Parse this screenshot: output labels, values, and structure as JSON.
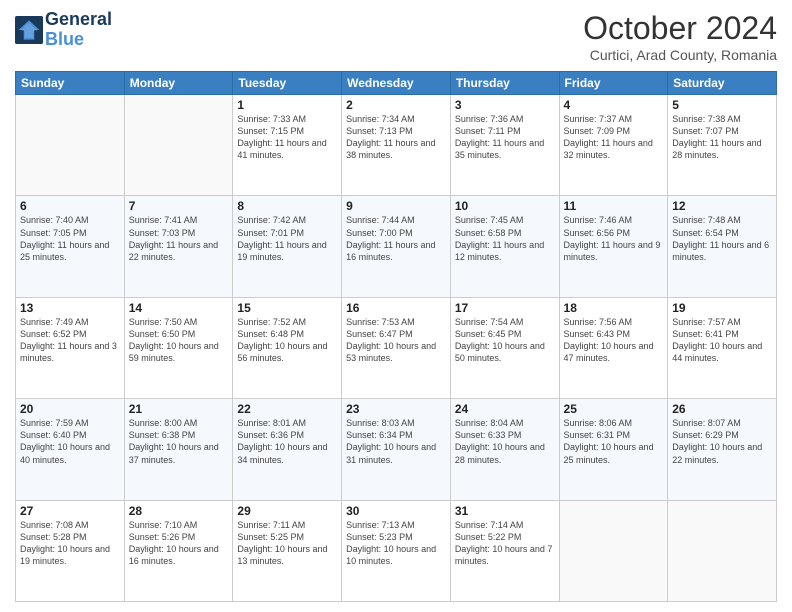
{
  "header": {
    "logo_line1": "General",
    "logo_line2": "Blue",
    "month_title": "October 2024",
    "location": "Curtici, Arad County, Romania"
  },
  "days_of_week": [
    "Sunday",
    "Monday",
    "Tuesday",
    "Wednesday",
    "Thursday",
    "Friday",
    "Saturday"
  ],
  "weeks": [
    [
      {
        "day": "",
        "info": ""
      },
      {
        "day": "",
        "info": ""
      },
      {
        "day": "1",
        "info": "Sunrise: 7:33 AM\nSunset: 7:15 PM\nDaylight: 11 hours and 41 minutes."
      },
      {
        "day": "2",
        "info": "Sunrise: 7:34 AM\nSunset: 7:13 PM\nDaylight: 11 hours and 38 minutes."
      },
      {
        "day": "3",
        "info": "Sunrise: 7:36 AM\nSunset: 7:11 PM\nDaylight: 11 hours and 35 minutes."
      },
      {
        "day": "4",
        "info": "Sunrise: 7:37 AM\nSunset: 7:09 PM\nDaylight: 11 hours and 32 minutes."
      },
      {
        "day": "5",
        "info": "Sunrise: 7:38 AM\nSunset: 7:07 PM\nDaylight: 11 hours and 28 minutes."
      }
    ],
    [
      {
        "day": "6",
        "info": "Sunrise: 7:40 AM\nSunset: 7:05 PM\nDaylight: 11 hours and 25 minutes."
      },
      {
        "day": "7",
        "info": "Sunrise: 7:41 AM\nSunset: 7:03 PM\nDaylight: 11 hours and 22 minutes."
      },
      {
        "day": "8",
        "info": "Sunrise: 7:42 AM\nSunset: 7:01 PM\nDaylight: 11 hours and 19 minutes."
      },
      {
        "day": "9",
        "info": "Sunrise: 7:44 AM\nSunset: 7:00 PM\nDaylight: 11 hours and 16 minutes."
      },
      {
        "day": "10",
        "info": "Sunrise: 7:45 AM\nSunset: 6:58 PM\nDaylight: 11 hours and 12 minutes."
      },
      {
        "day": "11",
        "info": "Sunrise: 7:46 AM\nSunset: 6:56 PM\nDaylight: 11 hours and 9 minutes."
      },
      {
        "day": "12",
        "info": "Sunrise: 7:48 AM\nSunset: 6:54 PM\nDaylight: 11 hours and 6 minutes."
      }
    ],
    [
      {
        "day": "13",
        "info": "Sunrise: 7:49 AM\nSunset: 6:52 PM\nDaylight: 11 hours and 3 minutes."
      },
      {
        "day": "14",
        "info": "Sunrise: 7:50 AM\nSunset: 6:50 PM\nDaylight: 10 hours and 59 minutes."
      },
      {
        "day": "15",
        "info": "Sunrise: 7:52 AM\nSunset: 6:48 PM\nDaylight: 10 hours and 56 minutes."
      },
      {
        "day": "16",
        "info": "Sunrise: 7:53 AM\nSunset: 6:47 PM\nDaylight: 10 hours and 53 minutes."
      },
      {
        "day": "17",
        "info": "Sunrise: 7:54 AM\nSunset: 6:45 PM\nDaylight: 10 hours and 50 minutes."
      },
      {
        "day": "18",
        "info": "Sunrise: 7:56 AM\nSunset: 6:43 PM\nDaylight: 10 hours and 47 minutes."
      },
      {
        "day": "19",
        "info": "Sunrise: 7:57 AM\nSunset: 6:41 PM\nDaylight: 10 hours and 44 minutes."
      }
    ],
    [
      {
        "day": "20",
        "info": "Sunrise: 7:59 AM\nSunset: 6:40 PM\nDaylight: 10 hours and 40 minutes."
      },
      {
        "day": "21",
        "info": "Sunrise: 8:00 AM\nSunset: 6:38 PM\nDaylight: 10 hours and 37 minutes."
      },
      {
        "day": "22",
        "info": "Sunrise: 8:01 AM\nSunset: 6:36 PM\nDaylight: 10 hours and 34 minutes."
      },
      {
        "day": "23",
        "info": "Sunrise: 8:03 AM\nSunset: 6:34 PM\nDaylight: 10 hours and 31 minutes."
      },
      {
        "day": "24",
        "info": "Sunrise: 8:04 AM\nSunset: 6:33 PM\nDaylight: 10 hours and 28 minutes."
      },
      {
        "day": "25",
        "info": "Sunrise: 8:06 AM\nSunset: 6:31 PM\nDaylight: 10 hours and 25 minutes."
      },
      {
        "day": "26",
        "info": "Sunrise: 8:07 AM\nSunset: 6:29 PM\nDaylight: 10 hours and 22 minutes."
      }
    ],
    [
      {
        "day": "27",
        "info": "Sunrise: 7:08 AM\nSunset: 5:28 PM\nDaylight: 10 hours and 19 minutes."
      },
      {
        "day": "28",
        "info": "Sunrise: 7:10 AM\nSunset: 5:26 PM\nDaylight: 10 hours and 16 minutes."
      },
      {
        "day": "29",
        "info": "Sunrise: 7:11 AM\nSunset: 5:25 PM\nDaylight: 10 hours and 13 minutes."
      },
      {
        "day": "30",
        "info": "Sunrise: 7:13 AM\nSunset: 5:23 PM\nDaylight: 10 hours and 10 minutes."
      },
      {
        "day": "31",
        "info": "Sunrise: 7:14 AM\nSunset: 5:22 PM\nDaylight: 10 hours and 7 minutes."
      },
      {
        "day": "",
        "info": ""
      },
      {
        "day": "",
        "info": ""
      }
    ]
  ]
}
